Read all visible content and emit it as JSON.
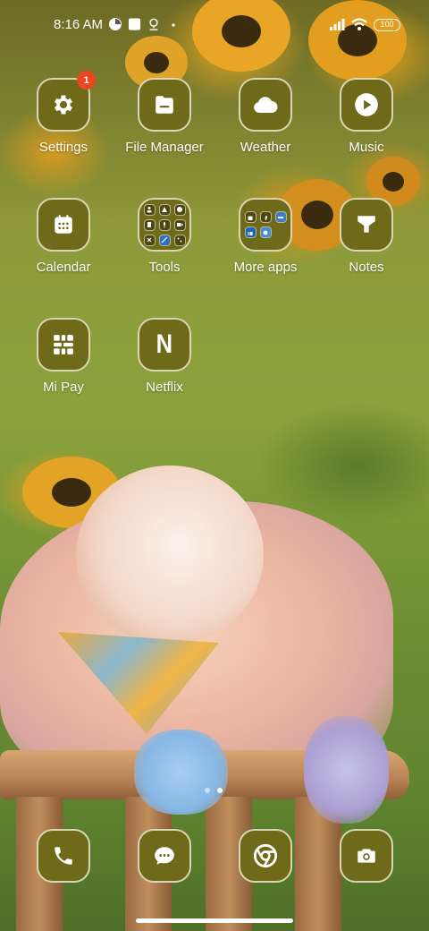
{
  "status_bar": {
    "time": "8:16 AM",
    "battery": "100",
    "icons": [
      "pie-status-icon",
      "square-status-icon",
      "location-status-icon",
      "dot-status-icon",
      "signal-icon",
      "wifi-icon",
      "battery-icon"
    ]
  },
  "apps": [
    {
      "label": "Settings",
      "icon": "gear-icon",
      "badge": "1"
    },
    {
      "label": "File Manager",
      "icon": "folder-icon"
    },
    {
      "label": "Weather",
      "icon": "cloud-icon"
    },
    {
      "label": "Music",
      "icon": "play-icon"
    },
    {
      "label": "Calendar",
      "icon": "calendar-icon"
    },
    {
      "label": "Tools",
      "icon": "folder-grid-icon"
    },
    {
      "label": "More apps",
      "icon": "folder-grid-icon"
    },
    {
      "label": "Notes",
      "icon": "funnel-icon"
    },
    {
      "label": "Mi Pay",
      "icon": "mipay-icon"
    },
    {
      "label": "Netflix",
      "icon": "netflix-n-icon",
      "glyph": "N"
    }
  ],
  "pages": {
    "count": 2,
    "active": 2
  },
  "dock": [
    {
      "name": "phone",
      "icon": "phone-icon"
    },
    {
      "name": "messages",
      "icon": "chat-icon"
    },
    {
      "name": "chrome",
      "icon": "chrome-icon"
    },
    {
      "name": "camera",
      "icon": "camera-icon"
    }
  ],
  "theme": {
    "tile_color": "#6e6a1a",
    "tile_border": "#d9d6b4",
    "badge_color": "#e8471f"
  }
}
